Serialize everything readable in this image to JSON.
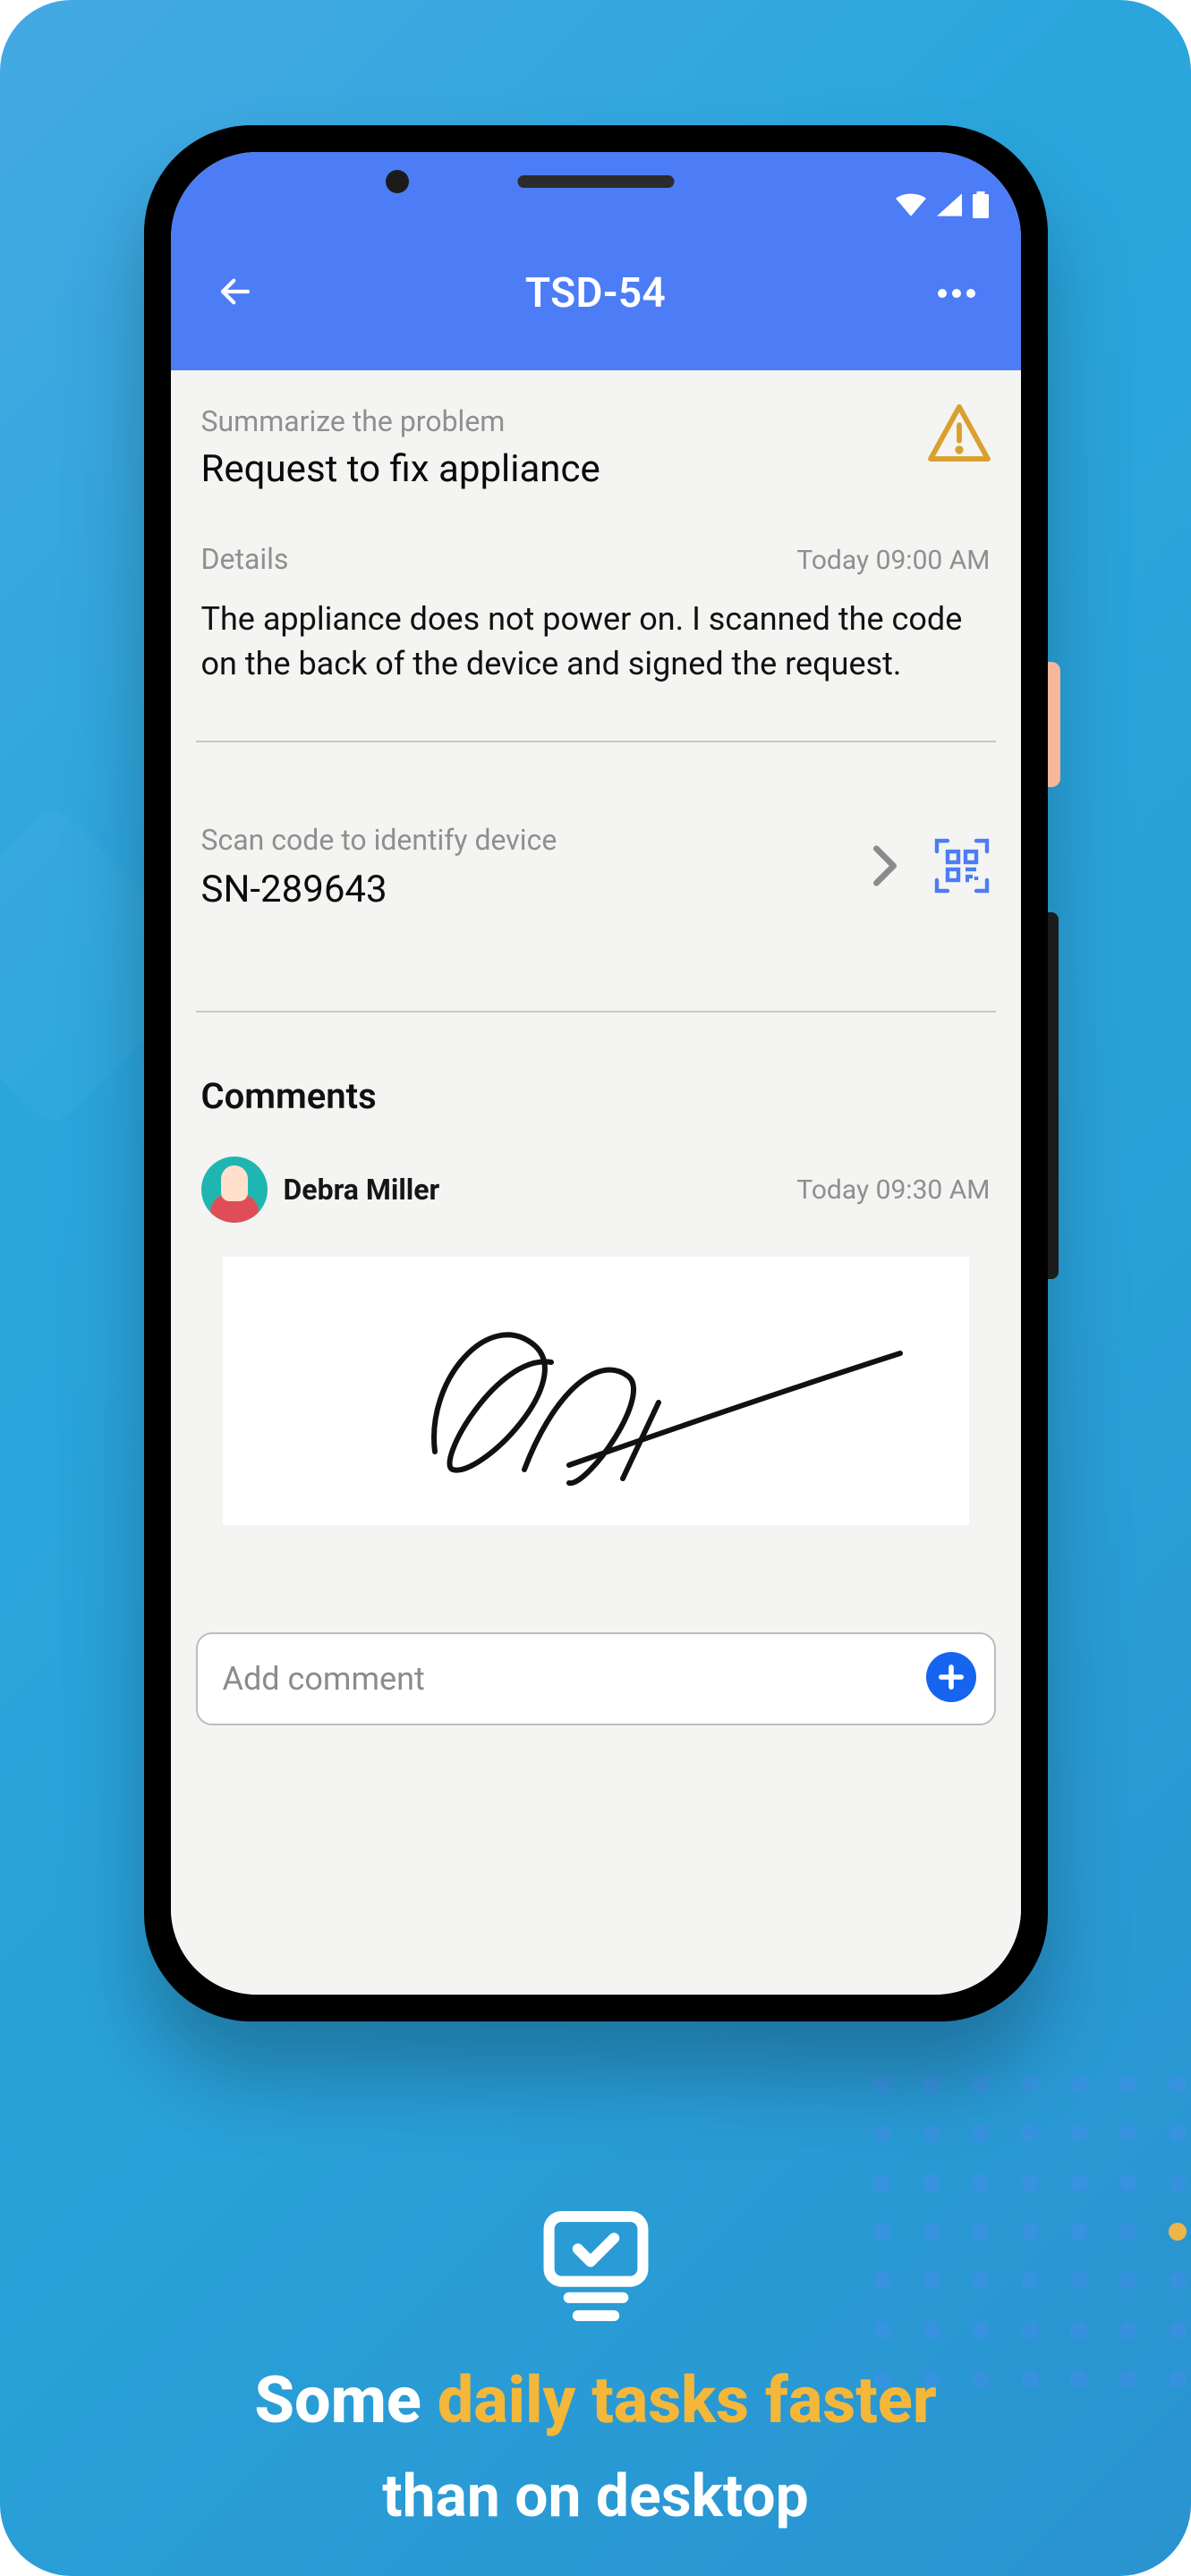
{
  "appBar": {
    "title": "TSD-54"
  },
  "summary": {
    "label": "Summarize the problem",
    "title": "Request to fix appliance"
  },
  "details": {
    "label": "Details",
    "timestamp": "Today 09:00 AM",
    "body": "The appliance does not power on. I scanned the code on the back of the device and signed the request."
  },
  "scan": {
    "label": "Scan code to identify device",
    "value": "SN-289643"
  },
  "comments": {
    "heading": "Comments",
    "items": [
      {
        "author": "Debra Miller",
        "timestamp": "Today 09:30 AM"
      }
    ],
    "addPlaceholder": "Add comment"
  },
  "promo": {
    "line1_prefix": "Some ",
    "line1_accent": "daily tasks faster",
    "line2": "than on desktop"
  }
}
